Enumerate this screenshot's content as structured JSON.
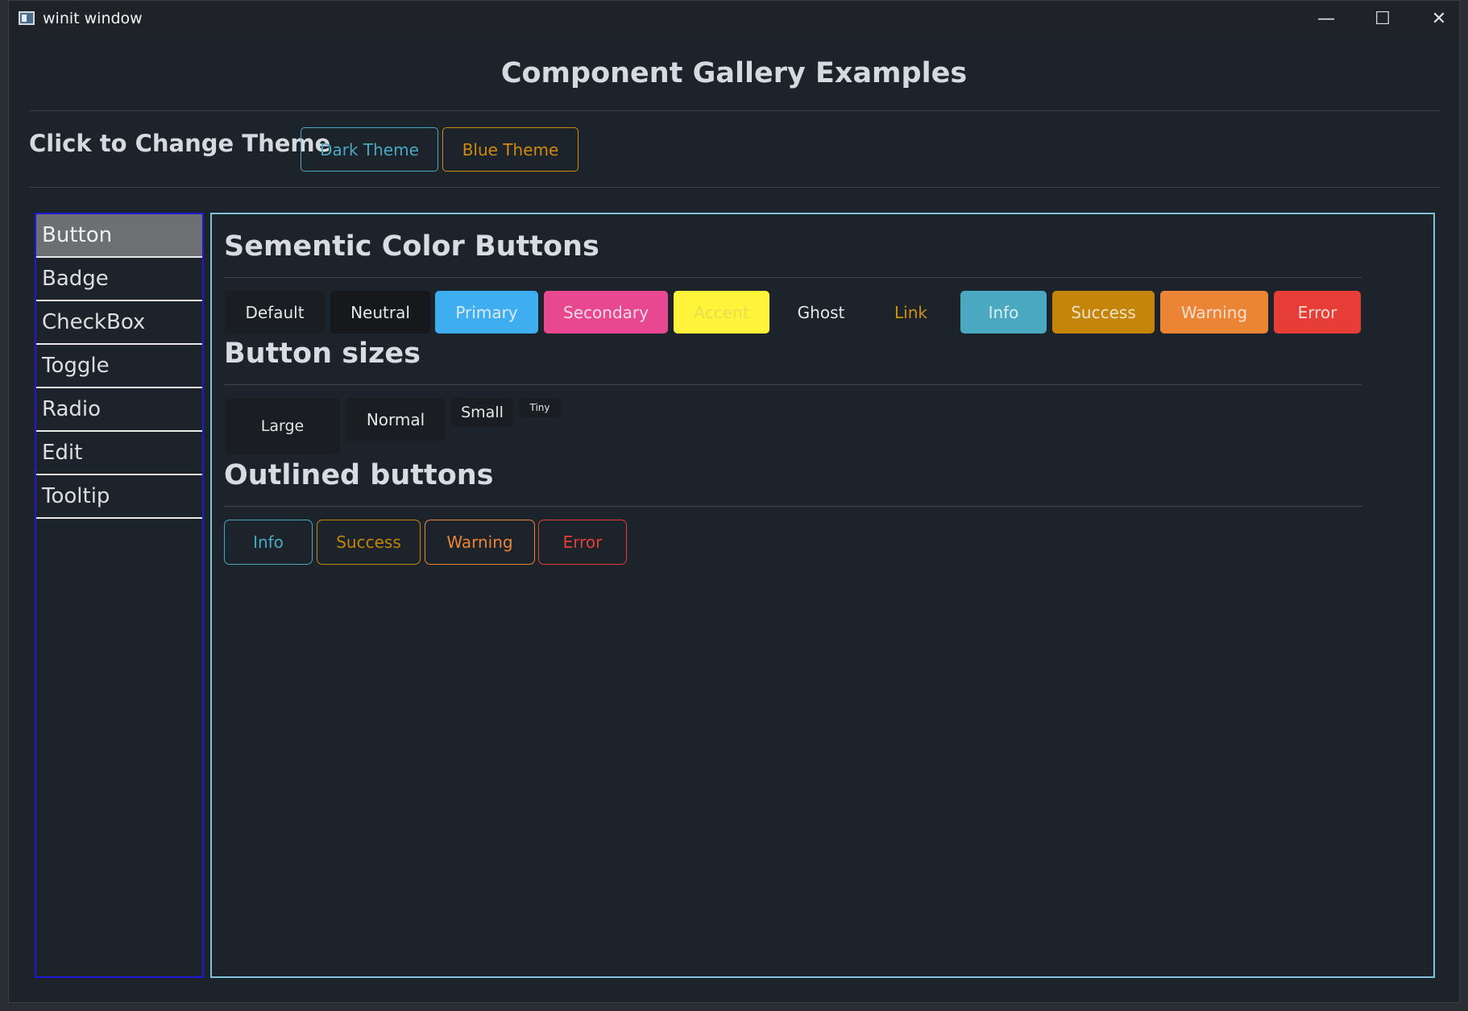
{
  "window": {
    "title": "winit window",
    "minimize_glyph": "—",
    "maximize_glyph": "☐",
    "close_glyph": "✕"
  },
  "header": {
    "title": "Component Gallery Examples"
  },
  "theme": {
    "label": "Click to Change Theme",
    "dark_label": "Dark Theme",
    "blue_label": "Blue Theme",
    "dark_color": "#4aa8c0",
    "blue_color": "#d08b0e"
  },
  "sidebar": {
    "items": [
      {
        "label": "Button",
        "active": true
      },
      {
        "label": "Badge"
      },
      {
        "label": "CheckBox"
      },
      {
        "label": "Toggle"
      },
      {
        "label": "Radio"
      },
      {
        "label": "Edit"
      },
      {
        "label": "Tooltip"
      }
    ]
  },
  "semantic": {
    "title": "Sementic Color Buttons",
    "buttons": [
      {
        "label": "Default",
        "bg": "#1a1d22",
        "fg": "#e6e6e6"
      },
      {
        "label": "Neutral",
        "bg": "#16181b",
        "fg": "#e6e6e6"
      },
      {
        "label": "Primary",
        "bg": "#3eaef0",
        "fg": "#dbe9f5"
      },
      {
        "label": "Secondary",
        "bg": "#e8488f",
        "fg": "#f2dbe6"
      },
      {
        "label": "Accent",
        "bg": "#fff43a",
        "fg": "#e6dd50"
      },
      {
        "label": "Ghost",
        "bg": "transparent",
        "fg": "#e6e6e6"
      },
      {
        "label": "Link",
        "bg": "transparent",
        "fg": "#d1900e"
      },
      {
        "label": "Info",
        "bg": "#4aa8c0",
        "fg": "#d9eef3"
      },
      {
        "label": "Success",
        "bg": "#c4850a",
        "fg": "#f0e3c6"
      },
      {
        "label": "Warning",
        "bg": "#ec8436",
        "fg": "#f6dfcd"
      },
      {
        "label": "Error",
        "bg": "#e63d36",
        "fg": "#f6d9d7"
      }
    ]
  },
  "sizes": {
    "title": "Button sizes",
    "buttons": [
      {
        "label": "Large"
      },
      {
        "label": "Normal"
      },
      {
        "label": "Small"
      },
      {
        "label": "Tiny"
      }
    ]
  },
  "outlined": {
    "title": "Outlined buttons",
    "buttons": [
      {
        "label": "Info",
        "color": "#4aa8c0"
      },
      {
        "label": "Success",
        "color": "#c4850a"
      },
      {
        "label": "Warning",
        "color": "#ec8436"
      },
      {
        "label": "Error",
        "color": "#e63d36"
      }
    ]
  }
}
